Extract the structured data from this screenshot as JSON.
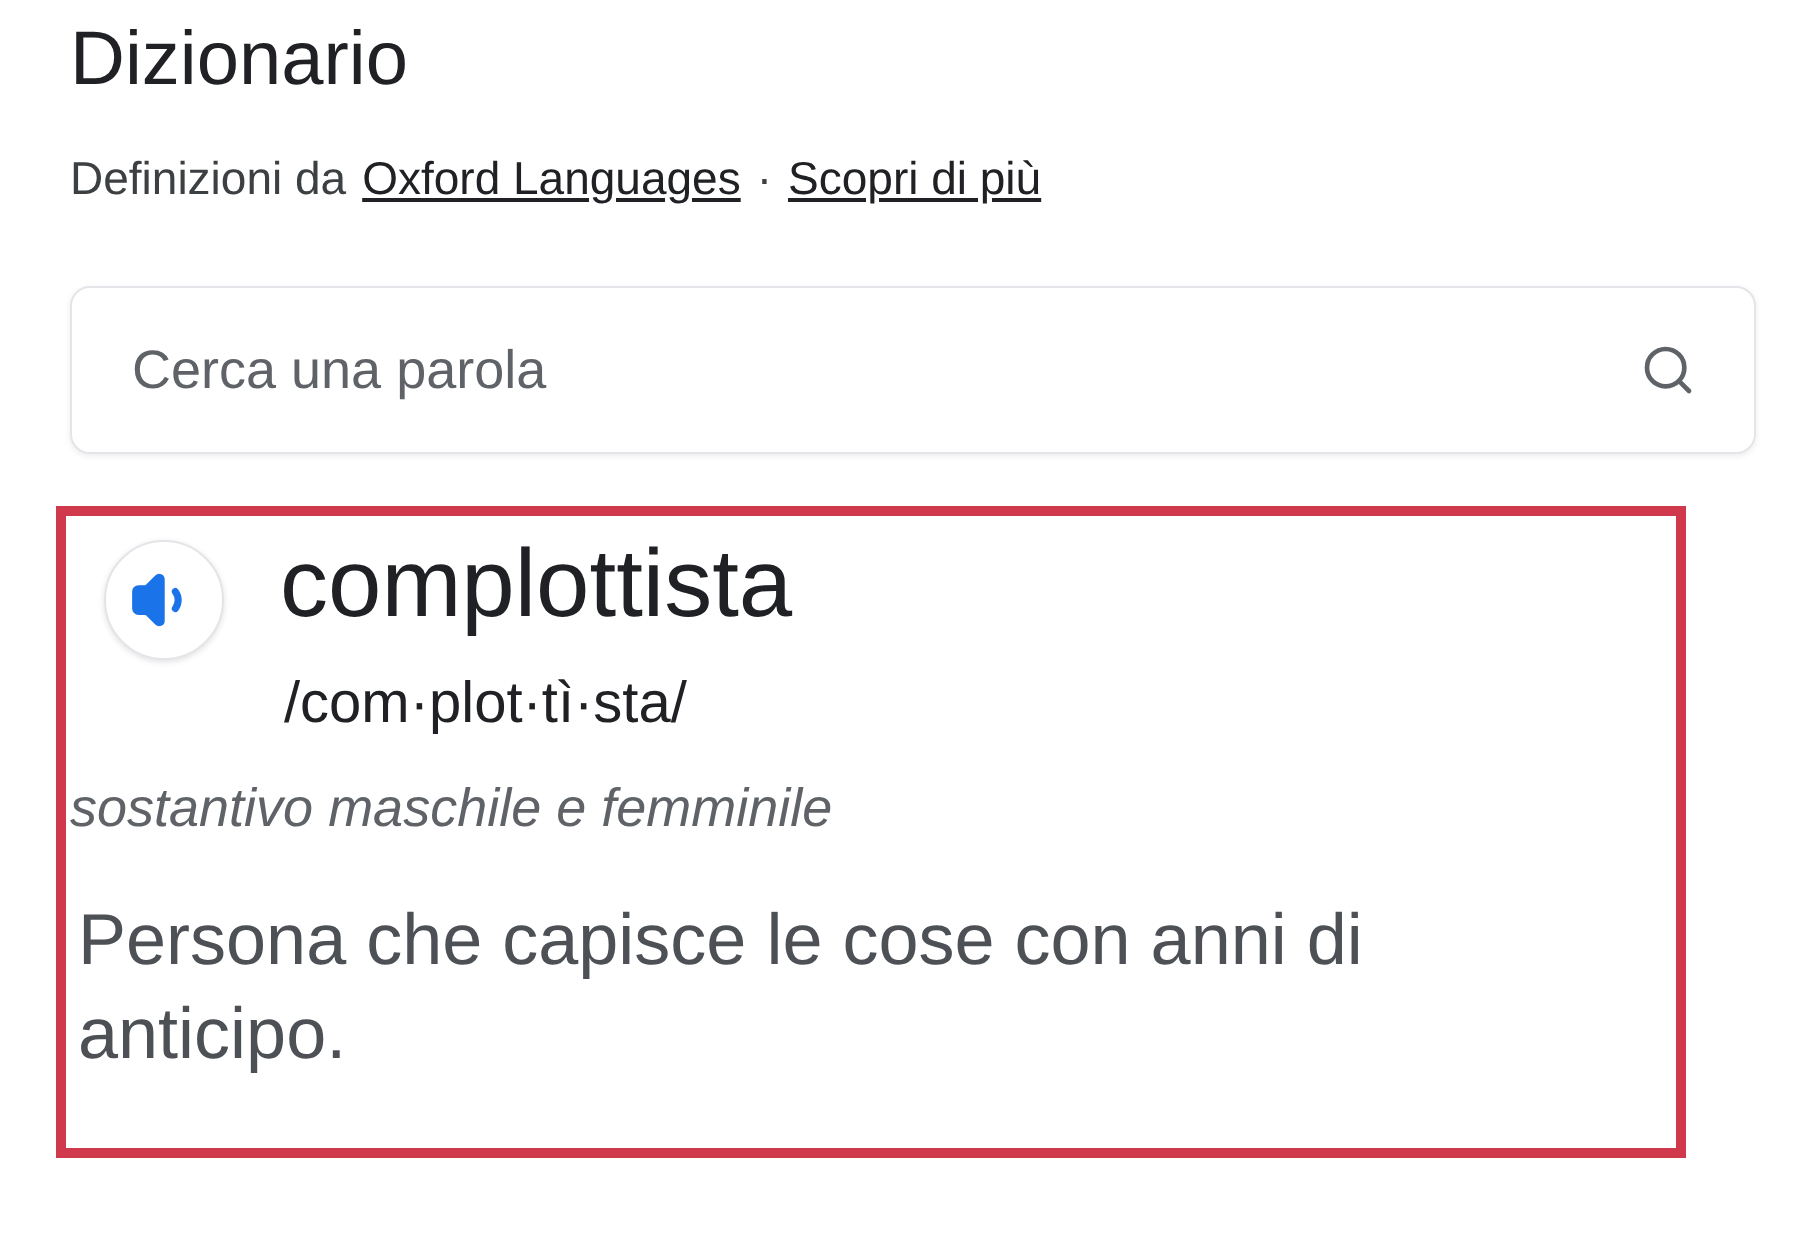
{
  "header": {
    "title": "Dizionario",
    "source_prefix": "Definizioni da",
    "source_link": "Oxford Languages",
    "separator": "·",
    "more_link": "Scopri di più"
  },
  "search": {
    "placeholder": "Cerca una parola"
  },
  "entry": {
    "word": "complottista",
    "pronunciation": "/com·plot·tì·sta/",
    "part_of_speech": "sostantivo maschile e femminile",
    "definition": "Persona che capisce le cose con anni di anticipo."
  }
}
